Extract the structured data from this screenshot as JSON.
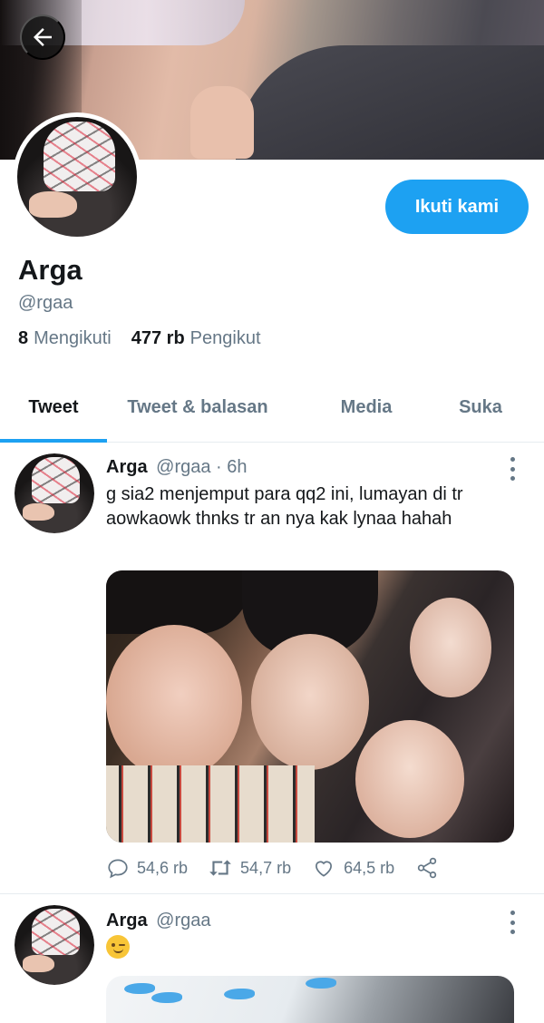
{
  "profile": {
    "display_name": "Arga",
    "handle": "@rgaa",
    "follow_label": "Ikuti kami",
    "following_count": "8",
    "following_label": "Mengikuti",
    "followers_count": "477 rb",
    "followers_label": "Pengikut"
  },
  "tabs": [
    {
      "label": "Tweet",
      "active": true
    },
    {
      "label": "Tweet & balasan",
      "active": false
    },
    {
      "label": "Media",
      "active": false
    },
    {
      "label": "Suka",
      "active": false
    }
  ],
  "tweets": [
    {
      "name": "Arga",
      "handle": "@rgaa",
      "time": "· 6h",
      "text": "g sia2 menjemput para qq2 ini, lumayan di tr aowkaowk thnks tr an nya kak lynaa hahah",
      "replies": "54,6 rb",
      "retweets": "54,7 rb",
      "likes": "64,5 rb"
    },
    {
      "name": "Arga",
      "handle": "@rgaa",
      "emoji": "winking-face-emoji"
    }
  ],
  "colors": {
    "accent": "#1da1f2",
    "muted": "#657786",
    "text": "#14171a"
  },
  "icons": [
    "back-arrow-icon",
    "more-vertical-icon",
    "reply-icon",
    "retweet-icon",
    "like-icon",
    "share-icon"
  ]
}
